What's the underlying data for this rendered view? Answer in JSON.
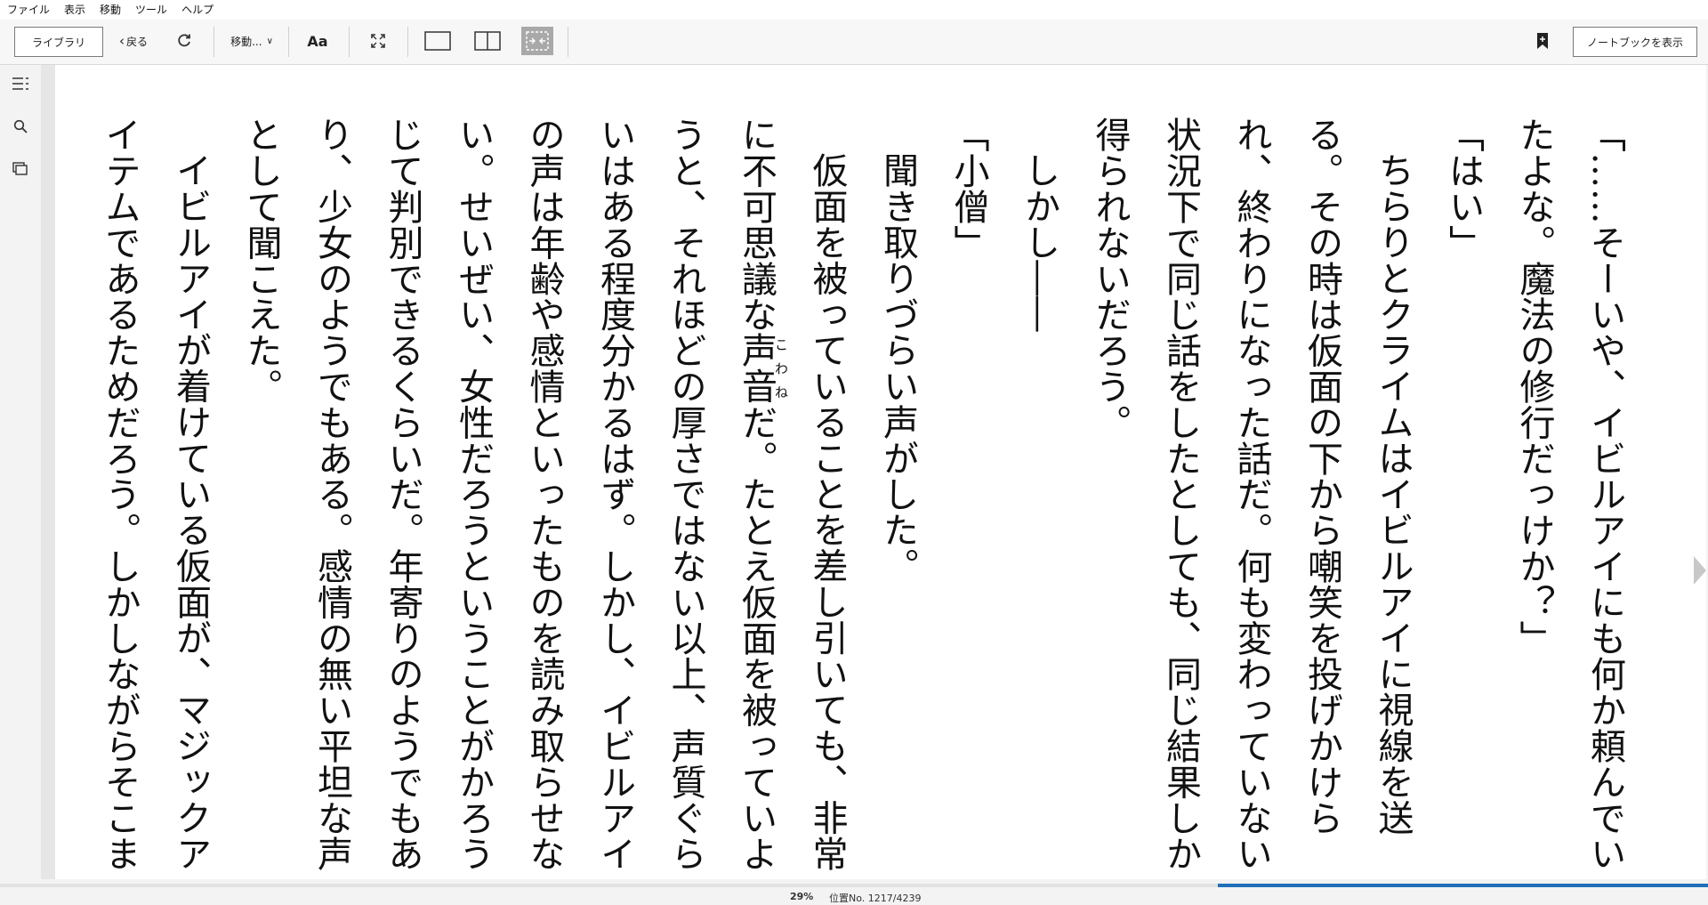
{
  "menu": [
    "ファイル",
    "表示",
    "移動",
    "ツール",
    "ヘルプ"
  ],
  "toolbar": {
    "library_label": "ライブラリ",
    "back_label": "戻る",
    "goto_label": "移動...",
    "font_label": "Aa",
    "notebook_label": "ノートブックを表示"
  },
  "content": {
    "paragraphs": [
      {
        "text": "「……そーいや、イビルアイにも何か頼んでいたよな。魔法の修行だっけか？」",
        "indent": false
      },
      {
        "text": "「はい」",
        "indent": false
      },
      {
        "text": "ちらりとクライムはイビルアイに視線を送る。その時は仮面の下から嘲笑を投げかけられ、終わりになった話だ。何も変わっていない状況下で同じ話をしたとしても、同じ結果しか得られないだろう。",
        "indent": true
      },
      {
        "text": "しかし――",
        "indent": true
      },
      {
        "text": "「小僧」",
        "indent": false
      },
      {
        "text": "聞き取りづらい声がした。",
        "indent": true
      }
    ],
    "ruby_para": {
      "before": "仮面を被っていることを差し引いても、非常に不可思議な",
      "ruby_base": "声音",
      "ruby_text": "こわね",
      "after": "だ。たとえ仮面を被っていようと、それほどの厚さではない以上、声質ぐらいはある程度分かるはず。しかし、イビルアイの声は年齢や感情といったものを読み取らせない。せいぜい、女性だろうということがかろうじて判別できるくらいだ。年寄りのようでもあり、少女のようでもある。感情の無い平坦な声として聞こえた。"
    },
    "last_para": "イビルアイが着けている仮面が、マジックアイテムであるためだろう。しかしながらそこま"
  },
  "status": {
    "percent": "29%",
    "location": "位置No. 1217/4239",
    "progress_fraction": 0.287
  },
  "colors": {
    "progress": "#1f6fb8",
    "active_view_bg": "#a9a9a9"
  }
}
